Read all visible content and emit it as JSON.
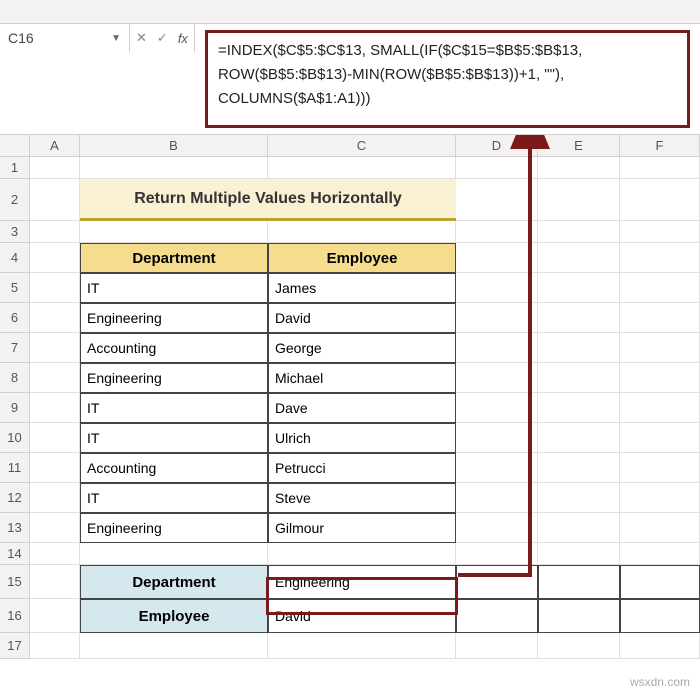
{
  "namebox": {
    "value": "C16"
  },
  "formula_bar": {
    "line1": "=INDEX($C$5:$C$13, SMALL(IF($C$15=$B$5:$B$13,",
    "line2": "ROW($B$5:$B$13)-MIN(ROW($B$5:$B$13))+1, \"\"),",
    "line3": "COLUMNS($A$1:A1)))"
  },
  "columns": [
    "A",
    "B",
    "C",
    "D",
    "E",
    "F"
  ],
  "rows": [
    "1",
    "2",
    "3",
    "4",
    "5",
    "6",
    "7",
    "8",
    "9",
    "10",
    "11",
    "12",
    "13",
    "14",
    "15",
    "16",
    "17"
  ],
  "title": "Return Multiple Values Horizontally",
  "table": {
    "headers": {
      "dept": "Department",
      "emp": "Employee"
    },
    "rows": [
      {
        "dept": "IT",
        "emp": "James"
      },
      {
        "dept": "Engineering",
        "emp": "David"
      },
      {
        "dept": "Accounting",
        "emp": "George"
      },
      {
        "dept": "Engineering",
        "emp": "Michael"
      },
      {
        "dept": "IT",
        "emp": "Dave"
      },
      {
        "dept": "IT",
        "emp": "Ulrich"
      },
      {
        "dept": "Accounting",
        "emp": "Petrucci"
      },
      {
        "dept": "IT",
        "emp": "Steve"
      },
      {
        "dept": "Engineering",
        "emp": "Gilmour"
      }
    ]
  },
  "lookup": {
    "dept_label": "Department",
    "emp_label": "Employee",
    "dept_value": "Engineering",
    "emp_value": "David"
  },
  "watermark": "wsxdn.com",
  "fx_label": "fx",
  "cancel_glyph": "✕",
  "accept_glyph": "✓"
}
